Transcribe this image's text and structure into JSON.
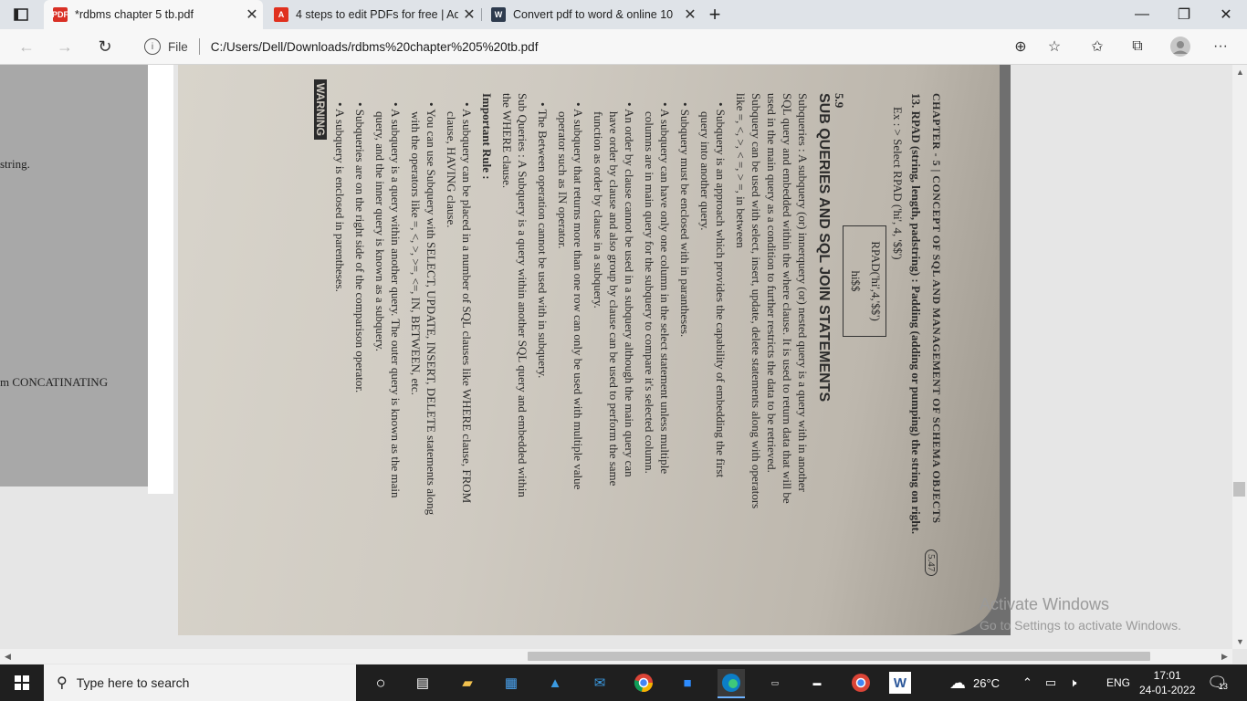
{
  "browser": {
    "tabs": [
      {
        "title": "*rdbms chapter 5 tb.pdf",
        "icon": "pdf-icon"
      },
      {
        "title": "4 steps to edit PDFs for free | Ad",
        "icon": "adobe-icon"
      },
      {
        "title": "Convert pdf to word & online 10",
        "icon": "converter-icon"
      }
    ],
    "new_tab_label": "+",
    "address": {
      "scheme_label": "File",
      "url": "C:/Users/Dell/Downloads/rdbms%20chapter%205%20tb.pdf"
    }
  },
  "document": {
    "left_page_text_1": "string.",
    "left_page_text_2": "m CONCATINATING",
    "page": {
      "chapter_header": "CHAPTER - 5 | CONCEPT OF SQL AND MANAGEMENT OF SCHEMA OBJECTS",
      "page_number": "5.47",
      "lines": [
        "13. RPAD (string, length, padstring) : Padding (adding or pumping) the string on right.",
        "Ex : > Select RPAD ('hi', 4, '$$')",
        "5.9",
        "Subqueries : A subquery (or) innerquery (or) nested query is a query with in another",
        "SQL query and embedded within the where clause. It is used to return data that will be",
        "used in the main query as a condition to further restricts the data to be retrieved.",
        "Subquery can be used with select, insert, update, delete statements along with operators",
        "like =, <, >, < =, > =, in between",
        "• Subquery is an approach which provides the capability of embedding the first",
        "query into another query.",
        "• Subquery must be enclosed with in parantheses.",
        "• A subquery can have only one column in the select statement unless multiple",
        "columns are in main query for the subquery to compare it's selected column.",
        "• An order by clause cannot be used in a subquery although the main query can",
        "have order by clause and also group by clause can be used to perform the same",
        "function as order by clause in a subquery.",
        "• A subquery that returns more than one row can only be used with multiple value",
        "operator such as IN operator.",
        "• The Between operation cannot be used with in subquery.",
        "Sub Queries : A Subquery is a query within another SQL query and embedded within",
        "the WHERE clause.",
        "Important Rule :",
        "• A subquery can be placed in a number of SQL clauses like WHERE clause, FROM",
        "clause, HAVING clause.",
        "• You can use Subquery with SELECT, UPDATE, INSERT, DELETE statements along",
        "with the operators like =, <, >, >=, <=, IN, BETWEEN, etc.",
        "• A subquery is a query within another query. The outer query is known as the main",
        "query, and the inner query is known as a subquery.",
        "• Subqueries are on the right side of the comparison operator.",
        "• A subquery is enclosed in parentheses."
      ],
      "box_line_1": "RPAD('hi',4,'$$')",
      "box_line_2": "hi$$",
      "section_title": "SUB QUERIES AND SQL JOIN STATEMENTS",
      "footer_stamp": "WARNING"
    },
    "watermark_title": "Activate Windows",
    "watermark_sub": "Go to Settings to activate Windows."
  },
  "taskbar": {
    "search_placeholder": "Type here to search",
    "weather": "26°C",
    "language": "ENG",
    "time": "17:01",
    "date": "24-01-2022",
    "notifications": "13"
  }
}
